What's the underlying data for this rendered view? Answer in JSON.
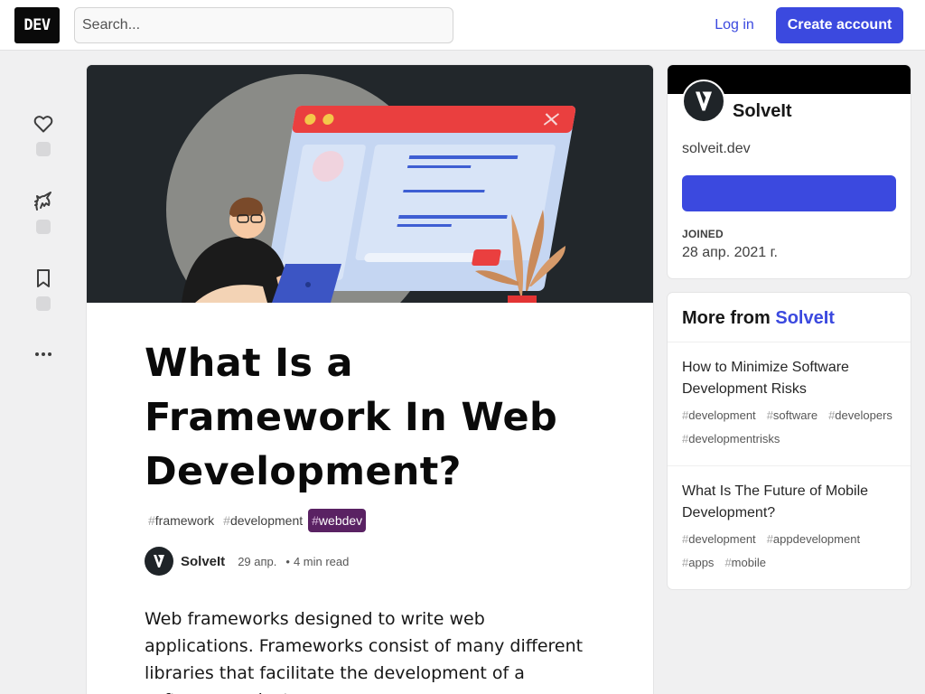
{
  "header": {
    "logo": "DEV",
    "search_placeholder": "Search...",
    "login_label": "Log in",
    "create_label": "Create account",
    "accent": "#3b49df"
  },
  "reactions": {
    "items": [
      {
        "icon": "heart-icon"
      },
      {
        "icon": "unicorn-icon"
      },
      {
        "icon": "bookmark-icon"
      }
    ],
    "more_icon": "more-horizontal-icon"
  },
  "article": {
    "title": "What Is a Framework In Web Development?",
    "tags": [
      {
        "hash": "#",
        "name": "framework"
      },
      {
        "hash": "#",
        "name": "development"
      },
      {
        "hash": "#",
        "name": "webdev",
        "active": true,
        "color": "#5a2263"
      }
    ],
    "author": "SolveIt",
    "date": "29 апр.",
    "separator": "•",
    "read_time": "4 min read",
    "body": "Web frameworks designed to write web applications. Frameworks consist of many different libraries that facilitate the development of a software product or"
  },
  "sidebar": {
    "org_name": "SolveIt",
    "org_url": "solveit.dev",
    "follow_label": "",
    "joined_label": "JOINED",
    "joined_date": "28 апр. 2021 г.",
    "more_prefix": "More from",
    "more_brand": "SolveIt",
    "more_posts": [
      {
        "title": "How to Minimize Software Development Risks",
        "tags": [
          {
            "hash": "#",
            "name": "development"
          },
          {
            "hash": "#",
            "name": "software"
          },
          {
            "hash": "#",
            "name": "developers"
          },
          {
            "hash": "#",
            "name": "developmentrisks"
          }
        ]
      },
      {
        "title": "What Is The Future of Mobile Development?",
        "tags": [
          {
            "hash": "#",
            "name": "development"
          },
          {
            "hash": "#",
            "name": "appdevelopment"
          },
          {
            "hash": "#",
            "name": "apps"
          },
          {
            "hash": "#",
            "name": "mobile"
          }
        ]
      }
    ]
  }
}
